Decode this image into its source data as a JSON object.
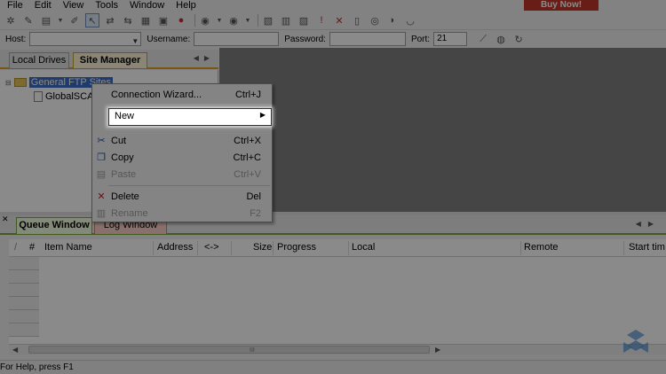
{
  "menubar": {
    "items": [
      "File",
      "Edit",
      "View",
      "Tools",
      "Window",
      "Help"
    ],
    "buy_label": "Buy Now!"
  },
  "toolbar": {
    "icons": [
      "connect-icon",
      "wizard-icon",
      "new-icon",
      "dropdown-icon",
      "edit-icon",
      "cursor-icon",
      "transfer-icon",
      "transfer2-icon",
      "schedule-icon",
      "stop-icon",
      "download-icon",
      "upload-icon",
      "folder-icon",
      "queue-icon",
      "lock-icon",
      "priority-icon",
      "delete-icon",
      "properties-icon",
      "help-icon",
      "headset-icon",
      "shield-icon"
    ]
  },
  "quickconnect": {
    "host_label": "Host:",
    "username_label": "Username:",
    "password_label": "Password:",
    "port_label": "Port:",
    "port_value": "21"
  },
  "sidebar": {
    "tabs": [
      "Local Drives",
      "Site Manager"
    ],
    "tree": {
      "root": "General FTP Sites",
      "child": "GlobalSCA"
    }
  },
  "context_menu": {
    "items": [
      {
        "label": "Connection Wizard...",
        "shortcut": "Ctrl+J",
        "enabled": true
      },
      {
        "label": "New",
        "shortcut": "",
        "enabled": true
      },
      {
        "label": "Cut",
        "shortcut": "Ctrl+X",
        "enabled": true
      },
      {
        "label": "Copy",
        "shortcut": "Ctrl+C",
        "enabled": true
      },
      {
        "label": "Paste",
        "shortcut": "Ctrl+V",
        "enabled": false
      },
      {
        "label": "Delete",
        "shortcut": "Del",
        "enabled": true
      },
      {
        "label": "Rename",
        "shortcut": "F2",
        "enabled": false
      }
    ]
  },
  "queue": {
    "tabs": [
      "Queue Window",
      "Log Window"
    ],
    "columns": [
      "/",
      "#",
      "Item Name",
      "Address",
      "<->",
      "Size",
      "Progress",
      "Local",
      "Remote",
      "Start tim"
    ],
    "grip": "III"
  },
  "statusbar": {
    "text": "For Help, press F1"
  },
  "colors": {
    "dim_overlay": "#000000",
    "buy_button": "#c0392b",
    "site_tab_accent": "#e0a020",
    "queue_tab_accent": "#7aa83a"
  }
}
